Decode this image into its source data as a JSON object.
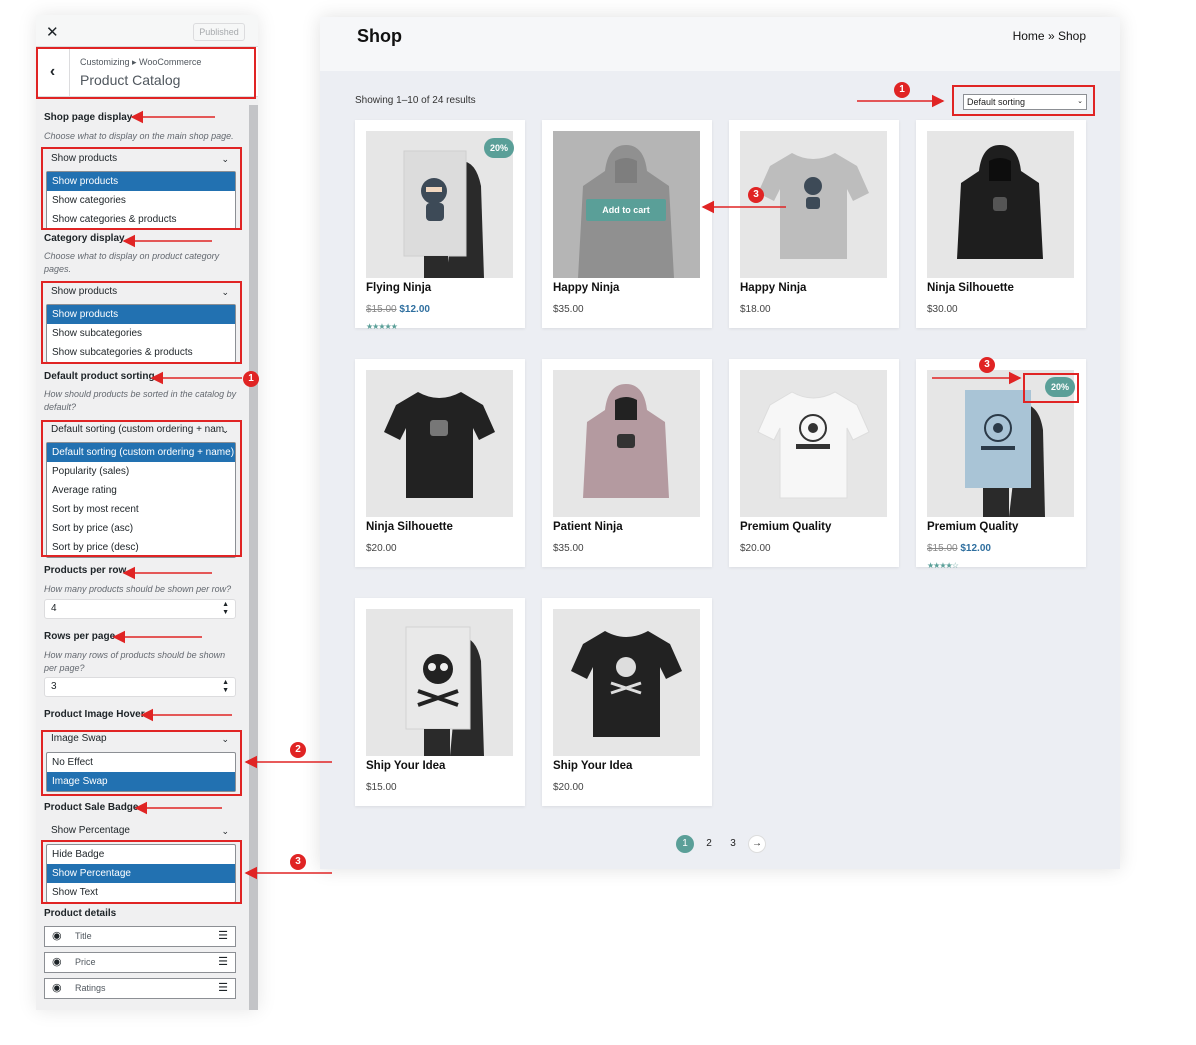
{
  "customizer": {
    "close_glyph": "✕",
    "published": "Published",
    "back_glyph": "‹",
    "breadcrumb": "Customizing ▸ WooCommerce",
    "section_title": "Product Catalog",
    "shop_page_display": {
      "label": "Shop page display",
      "description": "Choose what to display on the main shop page.",
      "selected": "Show products",
      "options": [
        "Show products",
        "Show categories",
        "Show categories & products"
      ]
    },
    "category_display": {
      "label": "Category display",
      "description": "Choose what to display on product category pages.",
      "selected": "Show products",
      "options": [
        "Show products",
        "Show subcategories",
        "Show subcategories & products"
      ]
    },
    "default_sorting": {
      "label": "Default product sorting",
      "description": "How should products be sorted in the catalog by default?",
      "selected": "Default sorting (custom ordering + nam",
      "options": [
        "Default sorting (custom ordering + name)",
        "Popularity (sales)",
        "Average rating",
        "Sort by most recent",
        "Sort by price (asc)",
        "Sort by price (desc)"
      ]
    },
    "products_per_row": {
      "label": "Products per row",
      "description": "How many products should be shown per row?",
      "value": "4"
    },
    "rows_per_page": {
      "label": "Rows per page",
      "description": "How many rows of products should be shown per page?",
      "value": "3"
    },
    "image_hover": {
      "label": "Product Image Hover",
      "selected": "Image Swap",
      "options": [
        "No Effect",
        "Image Swap"
      ]
    },
    "sale_badge": {
      "label": "Product Sale Badge",
      "selected": "Show Percentage",
      "options": [
        "Hide Badge",
        "Show Percentage",
        "Show Text"
      ]
    },
    "product_details": {
      "label": "Product details",
      "items": [
        "Title",
        "Price",
        "Ratings"
      ]
    }
  },
  "shop": {
    "title": "Shop",
    "breadcrumb_home": "Home",
    "breadcrumb_sep": "»",
    "breadcrumb_current": "Shop",
    "result_count": "Showing 1–10 of 24 results",
    "sorting_selected": "Default sorting",
    "add_to_cart": "Add to cart",
    "products": [
      {
        "name": "Flying Ninja",
        "old_price": "$15.00",
        "price": "$12.00",
        "badge": "20%",
        "rating": 5,
        "image": "poster-ninja"
      },
      {
        "name": "Happy Ninja",
        "price": "$35.00",
        "image": "hoodie-grey"
      },
      {
        "name": "Happy Ninja",
        "price": "$18.00",
        "image": "tshirt-grey"
      },
      {
        "name": "Ninja Silhouette",
        "price": "$30.00",
        "image": "hoodie-black"
      },
      {
        "name": "Ninja Silhouette",
        "price": "$20.00",
        "image": "tshirt-black"
      },
      {
        "name": "Patient Ninja",
        "price": "$35.00",
        "image": "hoodie-pink"
      },
      {
        "name": "Premium Quality",
        "price": "$20.00",
        "image": "tshirt-white"
      },
      {
        "name": "Premium Quality",
        "old_price": "$15.00",
        "price": "$12.00",
        "badge": "20%",
        "rating": 4,
        "image": "poster-woo"
      },
      {
        "name": "Ship Your Idea",
        "price": "$15.00",
        "image": "poster-skull"
      },
      {
        "name": "Ship Your Idea",
        "price": "$20.00",
        "image": "tshirt-skull"
      }
    ],
    "pagination": [
      "1",
      "2",
      "3",
      "→"
    ]
  },
  "annotations": {
    "marker_1": "1",
    "marker_2": "2",
    "marker_3": "3"
  },
  "colors": {
    "accent_teal": "#5a9f98",
    "wp_blue": "#2271b1",
    "annotation_red": "#e02424"
  }
}
